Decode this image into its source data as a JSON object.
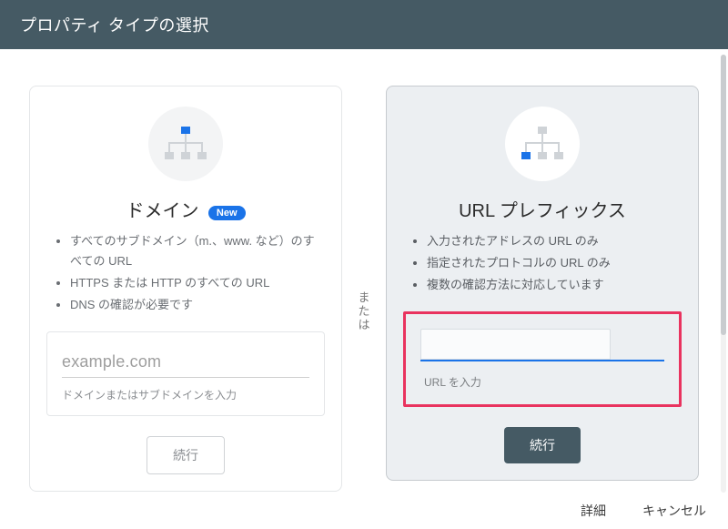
{
  "header": {
    "title": "プロパティ タイプの選択"
  },
  "dividerWord": "または",
  "domainCard": {
    "title": "ドメイン",
    "badge": "New",
    "bullets": [
      "すべてのサブドメイン（m.、www. など）のすべての URL",
      "HTTPS または HTTP のすべての URL",
      "DNS の確認が必要です"
    ],
    "inputValue": "example.com",
    "inputHint": "ドメインまたはサブドメインを入力",
    "button": "続行"
  },
  "urlCard": {
    "title": "URL プレフィックス",
    "bullets": [
      "入力されたアドレスの URL のみ",
      "指定されたプロトコルの URL のみ",
      "複数の確認方法に対応しています"
    ],
    "inputHint": "URL を入力",
    "button": "続行"
  },
  "footer": {
    "details": "詳細",
    "cancel": "キャンセル"
  },
  "icons": {
    "treeLeft": "sitemap-left-blue",
    "treeRight": "sitemap-right-blue"
  }
}
